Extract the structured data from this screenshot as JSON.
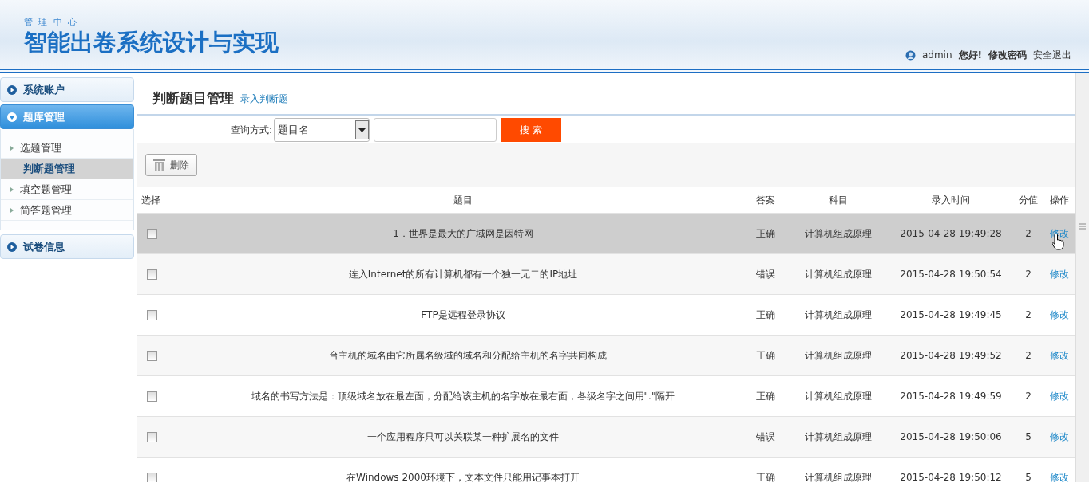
{
  "header": {
    "subtitle": "管 理 中 心",
    "title": "智能出卷系统设计与实现",
    "user": "admin",
    "greeting": "您好!",
    "links": [
      {
        "label": "修改密码",
        "bold": true
      },
      {
        "label": "安全退出",
        "bold": false
      }
    ]
  },
  "sidebar": {
    "groups": [
      {
        "label": "系统账户",
        "expanded": false
      },
      {
        "label": "题库管理",
        "expanded": true,
        "items": [
          {
            "label": "选题管理",
            "selected": false
          },
          {
            "label": "判断题管理",
            "selected": true
          },
          {
            "label": "填空题管理",
            "selected": false
          },
          {
            "label": "简答题管理",
            "selected": false
          }
        ]
      },
      {
        "label": "试卷信息",
        "expanded": false
      }
    ]
  },
  "page": {
    "title": "判断题目管理",
    "add_link": "录入判断题"
  },
  "search": {
    "label": "查询方式:",
    "select_value": "题目名",
    "button": "搜 索"
  },
  "toolbar": {
    "delete_button": "删除"
  },
  "table": {
    "columns": [
      "选择",
      "题目",
      "答案",
      "科目",
      "录入时间",
      "分值",
      "操作"
    ],
    "rows": [
      {
        "question": "1．世界是最大的广域网是因特网",
        "answer": "正确",
        "subject": "计算机组成原理",
        "time": "2015-04-28 19:49:28",
        "score": "2",
        "action": "修改",
        "checked": false,
        "highlighted": true
      },
      {
        "question": "连入Internet的所有计算机都有一个独一无二的IP地址",
        "answer": "错误",
        "subject": "计算机组成原理",
        "time": "2015-04-28 19:50:54",
        "score": "2",
        "action": "修改",
        "checked": false,
        "highlighted": false
      },
      {
        "question": "FTP是远程登录协议",
        "answer": "正确",
        "subject": "计算机组成原理",
        "time": "2015-04-28 19:49:45",
        "score": "2",
        "action": "修改",
        "checked": false,
        "highlighted": false
      },
      {
        "question": "一台主机的域名由它所属名级域的域名和分配给主机的名字共同构成",
        "answer": "正确",
        "subject": "计算机组成原理",
        "time": "2015-04-28 19:49:52",
        "score": "2",
        "action": "修改",
        "checked": false,
        "highlighted": false
      },
      {
        "question": "域名的书写方法是：顶级域名放在最左面，分配给该主机的名字放在最右面，各级名字之间用\".\"隔开",
        "answer": "正确",
        "subject": "计算机组成原理",
        "time": "2015-04-28 19:49:59",
        "score": "2",
        "action": "修改",
        "checked": false,
        "highlighted": false
      },
      {
        "question": "一个应用程序只可以关联某一种扩展名的文件",
        "answer": "错误",
        "subject": "计算机组成原理",
        "time": "2015-04-28 19:50:06",
        "score": "5",
        "action": "修改",
        "checked": false,
        "highlighted": false
      },
      {
        "question": "在Windows 2000环境下，文本文件只能用记事本打开",
        "answer": "正确",
        "subject": "计算机组成原理",
        "time": "2015-04-28 19:50:12",
        "score": "5",
        "action": "修改",
        "checked": false,
        "highlighted": false
      }
    ]
  }
}
